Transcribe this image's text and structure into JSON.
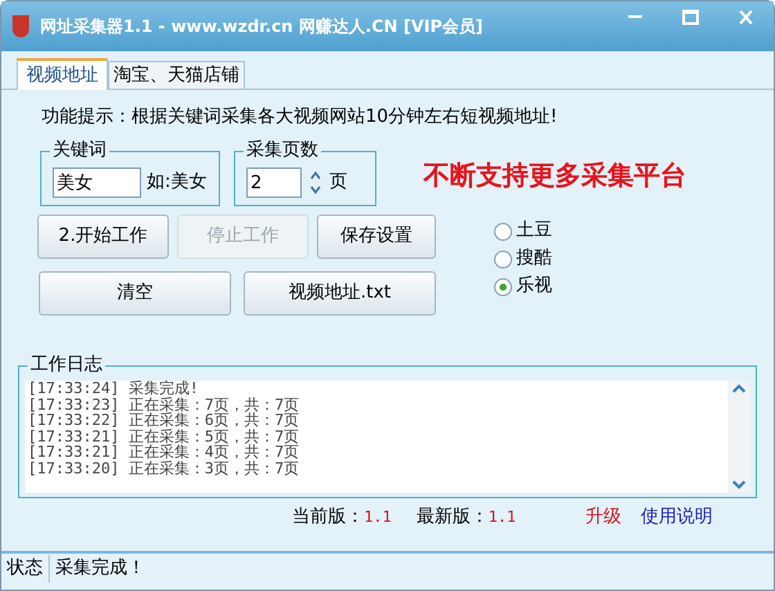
{
  "window": {
    "title": "网址采集器1.1 - www.wzdr.cn 网赚达人.CN [VIP会员]"
  },
  "tabs": [
    {
      "label": "视频地址",
      "selected": true
    },
    {
      "label": "淘宝、天猫店铺",
      "selected": false
    }
  ],
  "hint": "功能提示：根据关键词采集各大视频网站10分钟左右短视频地址!",
  "keyword": {
    "label": "关键词",
    "value": "美女",
    "example": "如:美女"
  },
  "pages": {
    "label": "采集页数",
    "value": "2",
    "unit": "页"
  },
  "slogan": "不断支持更多采集平台",
  "buttons": [
    {
      "label": "2.开始工作",
      "disabled": false
    },
    {
      "label": "停止工作",
      "disabled": true
    },
    {
      "label": "保存设置",
      "disabled": false
    },
    {
      "label": "清空",
      "disabled": false
    },
    {
      "label": "视频地址.txt",
      "disabled": false
    }
  ],
  "radios": [
    {
      "label": "土豆",
      "selected": false
    },
    {
      "label": "搜酷",
      "selected": false
    },
    {
      "label": "乐视",
      "selected": true
    }
  ],
  "log": {
    "title": "工作日志",
    "lines": [
      "[17:33:24] 采集完成!",
      "[17:33:23] 正在采集：7页，共：7页",
      "[17:33:22] 正在采集：6页，共：7页",
      "[17:33:21] 正在采集：5页，共：7页",
      "[17:33:21] 正在采集：4页，共：7页",
      "[17:33:20] 正在采集：3页，共：7页"
    ]
  },
  "version": {
    "current_label": "当前版：",
    "current": "1.1",
    "latest_label": "最新版：",
    "latest": "1.1",
    "upgrade": "升级",
    "help": "使用说明"
  },
  "status_bar": [
    "状态",
    "采集完成！"
  ]
}
